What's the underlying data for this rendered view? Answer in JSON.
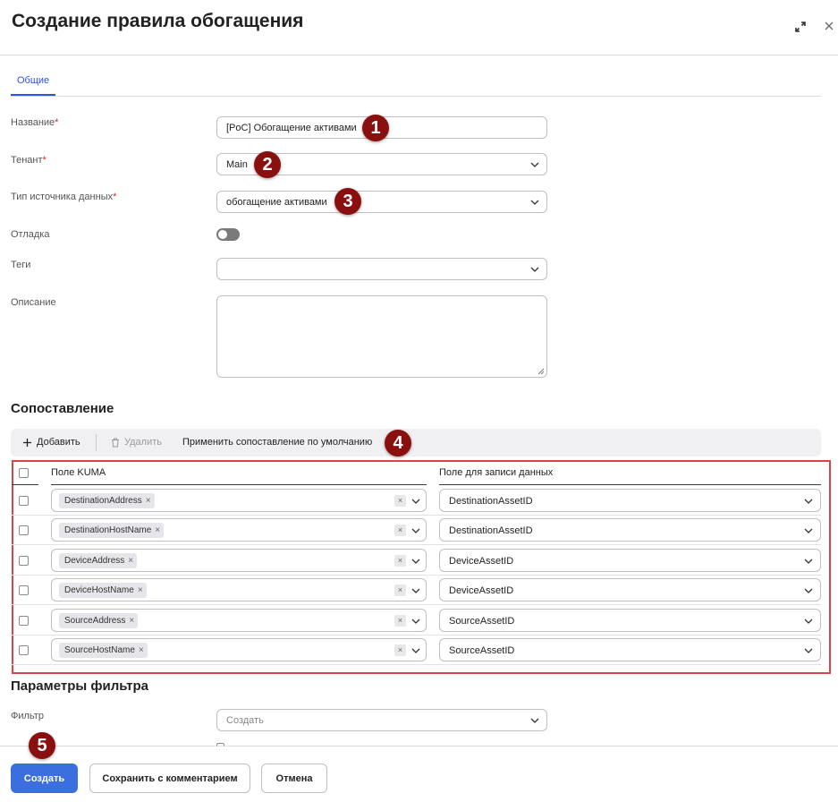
{
  "header": {
    "title": "Создание правила обогащения"
  },
  "tabs": [
    {
      "label": "Общие"
    }
  ],
  "form": {
    "name": {
      "label": "Название",
      "value": "[PoC] Обогащение активами"
    },
    "tenant": {
      "label": "Тенант",
      "value": "Main"
    },
    "source_type": {
      "label": "Тип источника данных",
      "value": "обогащение активами"
    },
    "debug": {
      "label": "Отладка",
      "enabled": false
    },
    "tags": {
      "label": "Теги",
      "value": ""
    },
    "description": {
      "label": "Описание",
      "value": ""
    },
    "required_mark": "*"
  },
  "mapping": {
    "title": "Сопоставление",
    "toolbar": {
      "add": "Добавить",
      "delete": "Удалить",
      "apply_default": "Применить сопоставление по умолчанию"
    },
    "columns": {
      "kuma_field": "Поле KUMA",
      "write_field": "Поле для записи данных"
    },
    "rows": [
      {
        "kuma": "DestinationAddress",
        "target": "DestinationAssetID"
      },
      {
        "kuma": "DestinationHostName",
        "target": "DestinationAssetID"
      },
      {
        "kuma": "DeviceAddress",
        "target": "DeviceAssetID"
      },
      {
        "kuma": "DeviceHostName",
        "target": "DeviceAssetID"
      },
      {
        "kuma": "SourceAddress",
        "target": "SourceAssetID"
      },
      {
        "kuma": "SourceHostName",
        "target": "SourceAssetID"
      }
    ]
  },
  "filter": {
    "title": "Параметры фильтра",
    "label": "Фильтр",
    "placeholder": "Создать"
  },
  "footer": {
    "create": "Создать",
    "save_comment": "Сохранить с комментарием",
    "cancel": "Отмена"
  },
  "markers": [
    "1",
    "2",
    "3",
    "4",
    "5"
  ],
  "colors": {
    "accent": "#3b6fe0",
    "tab_active": "#2c55d6",
    "highlight_frame": "#d9434a",
    "marker": "#8a1010",
    "required": "#d4262c"
  },
  "icons": {
    "expand": "expand-icon",
    "close": "close-icon",
    "plus": "plus-icon",
    "trash": "trash-icon",
    "chevron": "chevron-down-icon"
  }
}
